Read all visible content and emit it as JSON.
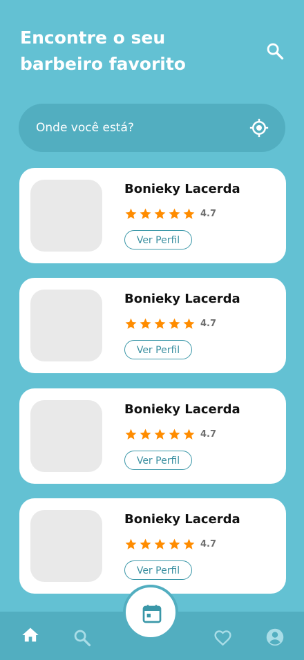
{
  "header": {
    "title_line1": "Encontre o seu",
    "title_line2": "barbeiro favorito"
  },
  "location": {
    "placeholder": "Onde você está?"
  },
  "barbers": [
    {
      "name": "Bonieky Lacerda",
      "rating": "4.7",
      "stars": 5,
      "button_label": "Ver Perfil"
    },
    {
      "name": "Bonieky Lacerda",
      "rating": "4.7",
      "stars": 5,
      "button_label": "Ver Perfil"
    },
    {
      "name": "Bonieky Lacerda",
      "rating": "4.7",
      "stars": 5,
      "button_label": "Ver Perfil"
    },
    {
      "name": "Bonieky Lacerda",
      "rating": "4.7",
      "stars": 5,
      "button_label": "Ver Perfil"
    }
  ],
  "colors": {
    "background": "#63c1d3",
    "accent_dark": "#52aec0",
    "star": "#ff8c00",
    "button_text": "#3a8fa0"
  },
  "bottom_nav": {
    "items": [
      "home-icon",
      "search-icon",
      "calendar-icon",
      "heart-icon",
      "account-icon"
    ],
    "active": "home-icon"
  }
}
